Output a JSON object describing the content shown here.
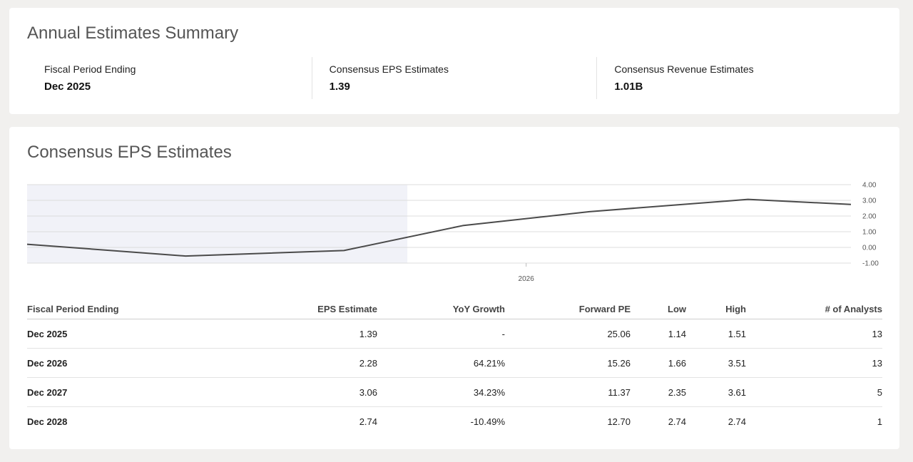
{
  "summary": {
    "title": "Annual Estimates Summary",
    "items": [
      {
        "label": "Fiscal Period Ending",
        "value": "Dec 2025"
      },
      {
        "label": "Consensus EPS Estimates",
        "value": "1.39"
      },
      {
        "label": "Consensus Revenue Estimates",
        "value": "1.01B"
      }
    ]
  },
  "eps_section": {
    "title": "Consensus EPS Estimates"
  },
  "chart_data": {
    "type": "line",
    "x": [
      2023,
      2024,
      2025,
      2026,
      2027,
      2028
    ],
    "x_tick_labels": [
      {
        "x": 2026,
        "label": "2026"
      }
    ],
    "y_ticks": [
      "4.00",
      "3.00",
      "2.00",
      "1.00",
      "0.00",
      "-1.00"
    ],
    "ylim": [
      -1,
      4
    ],
    "xlim": [
      2022.85,
      2028.05
    ],
    "shaded_x_range": [
      2022.85,
      2025.25
    ],
    "series": [
      {
        "values": [
          0.2,
          -0.55,
          -0.2,
          1.39,
          2.28,
          3.06,
          2.74
        ],
        "x": [
          2022.85,
          2023.85,
          2024.85,
          2025.6,
          2026.4,
          2027.4,
          2028.05
        ]
      }
    ],
    "line_color": "#4a4a4a",
    "shade_color": "#f1f2f8",
    "grid": true,
    "y_axis_position": "right"
  },
  "table": {
    "headers": {
      "period": "Fiscal Period Ending",
      "eps": "EPS Estimate",
      "yoy": "YoY Growth",
      "pe": "Forward PE",
      "low": "Low",
      "high": "High",
      "analysts": "# of Analysts"
    },
    "rows": [
      {
        "period": "Dec 2025",
        "eps": "1.39",
        "yoy": "-",
        "pe": "25.06",
        "low": "1.14",
        "high": "1.51",
        "analysts": "13"
      },
      {
        "period": "Dec 2026",
        "eps": "2.28",
        "yoy": "64.21%",
        "pe": "15.26",
        "low": "1.66",
        "high": "3.51",
        "analysts": "13"
      },
      {
        "period": "Dec 2027",
        "eps": "3.06",
        "yoy": "34.23%",
        "pe": "11.37",
        "low": "2.35",
        "high": "3.61",
        "analysts": "5"
      },
      {
        "period": "Dec 2028",
        "eps": "2.74",
        "yoy": "-10.49%",
        "pe": "12.70",
        "low": "2.74",
        "high": "2.74",
        "analysts": "1"
      }
    ]
  }
}
